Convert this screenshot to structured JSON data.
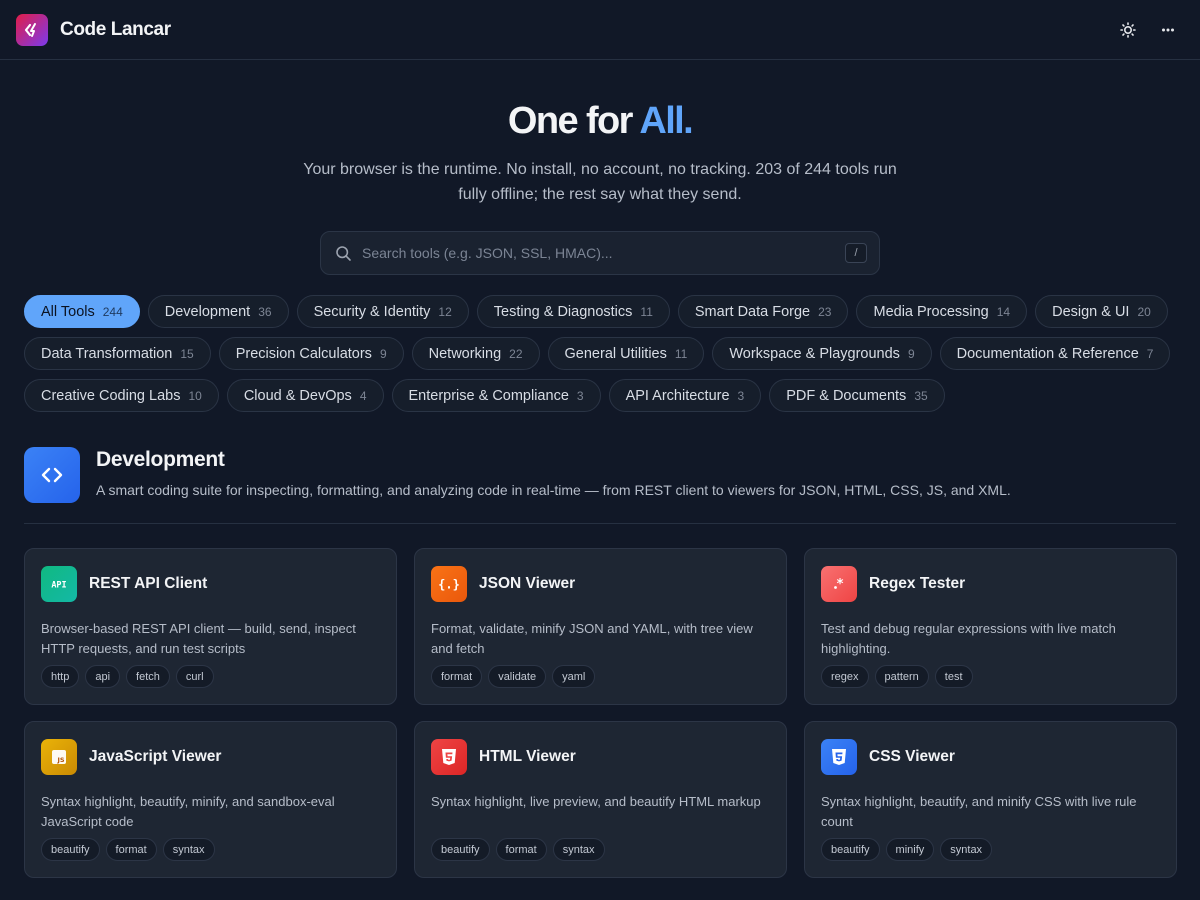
{
  "app": {
    "name": "Code Lancar"
  },
  "hero": {
    "title_part1": "One for",
    "title_accent": "All.",
    "subtitle": "Your browser is the runtime. No install, no account, no tracking. 203 of 244 tools run fully offline; the rest say what they send."
  },
  "search": {
    "placeholder": "Search tools (e.g. JSON, SSL, HMAC)...",
    "shortcut": "/"
  },
  "categories": [
    {
      "label": "All Tools",
      "count": "244",
      "active": true
    },
    {
      "label": "Development",
      "count": "36"
    },
    {
      "label": "Security & Identity",
      "count": "12"
    },
    {
      "label": "Testing & Diagnostics",
      "count": "11"
    },
    {
      "label": "Smart Data Forge",
      "count": "23"
    },
    {
      "label": "Media Processing",
      "count": "14"
    },
    {
      "label": "Design & UI",
      "count": "20"
    },
    {
      "label": "Data Transformation",
      "count": "15"
    },
    {
      "label": "Precision Calculators",
      "count": "9"
    },
    {
      "label": "Networking",
      "count": "22"
    },
    {
      "label": "General Utilities",
      "count": "11"
    },
    {
      "label": "Workspace & Playgrounds",
      "count": "9"
    },
    {
      "label": "Documentation & Reference",
      "count": "7"
    },
    {
      "label": "Creative Coding Labs",
      "count": "10"
    },
    {
      "label": "Cloud & DevOps",
      "count": "4"
    },
    {
      "label": "Enterprise & Compliance",
      "count": "3"
    },
    {
      "label": "API Architecture",
      "count": "3"
    },
    {
      "label": "PDF & Documents",
      "count": "35"
    }
  ],
  "section": {
    "title": "Development",
    "description": "A smart coding suite for inspecting, formatting, and analyzing code in real-time — from REST client to viewers for JSON, HTML, CSS, JS, and XML."
  },
  "tools": [
    {
      "title": "REST API Client",
      "icon": "api-icon",
      "color": "#10b981",
      "color2": "#14b8a6",
      "description": "Browser-based REST API client — build, send, inspect HTTP requests, and run test scripts",
      "tags": [
        "http",
        "api",
        "fetch",
        "curl"
      ]
    },
    {
      "title": "JSON Viewer",
      "icon": "braces-icon",
      "color": "#f97316",
      "color2": "#ea580c",
      "description": "Format, validate, minify JSON and YAML, with tree view and fetch",
      "tags": [
        "format",
        "validate",
        "yaml"
      ]
    },
    {
      "title": "Regex Tester",
      "icon": "asterisk-icon",
      "color": "#f87171",
      "color2": "#ef4444",
      "description": "Test and debug regular expressions with live match highlighting.",
      "tags": [
        "regex",
        "pattern",
        "test"
      ]
    },
    {
      "title": "JavaScript Viewer",
      "icon": "js-icon",
      "color": "#eab308",
      "color2": "#ca8a04",
      "description": "Syntax highlight, beautify, minify, and sandbox-eval JavaScript code",
      "tags": [
        "beautify",
        "format",
        "syntax"
      ]
    },
    {
      "title": "HTML Viewer",
      "icon": "html5-icon",
      "color": "#ef4444",
      "color2": "#dc2626",
      "description": "Syntax highlight, live preview, and beautify HTML markup",
      "tags": [
        "beautify",
        "format",
        "syntax"
      ]
    },
    {
      "title": "CSS Viewer",
      "icon": "css3-icon",
      "color": "#3b82f6",
      "color2": "#2563eb",
      "description": "Syntax highlight, beautify, and minify CSS with live rule count",
      "tags": [
        "beautify",
        "minify",
        "syntax"
      ]
    }
  ]
}
